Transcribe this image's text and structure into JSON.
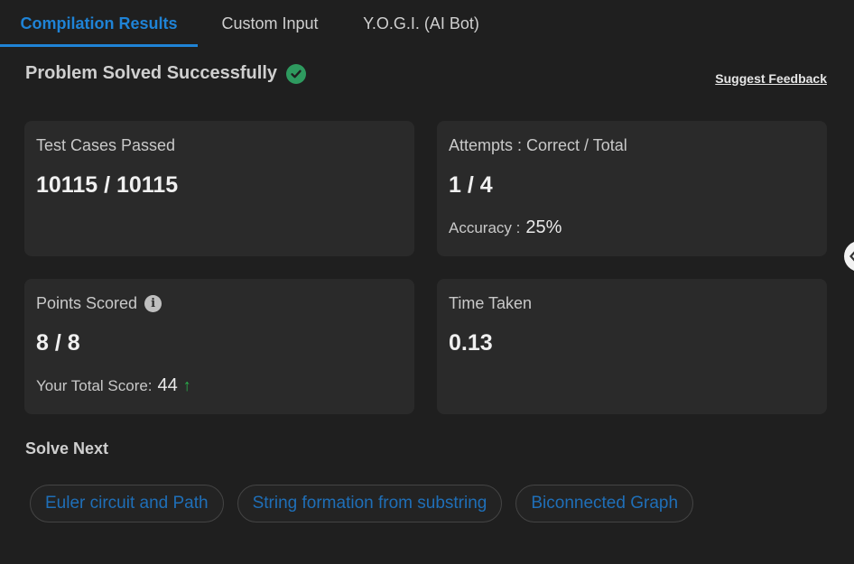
{
  "tabs": [
    {
      "label": "Compilation Results",
      "active": true
    },
    {
      "label": "Custom Input",
      "active": false
    },
    {
      "label": "Y.O.G.I. (AI Bot)",
      "active": false
    }
  ],
  "status": {
    "message": "Problem Solved Successfully",
    "icon": "check-circle-icon"
  },
  "feedback_link": "Suggest Feedback",
  "cards": {
    "test_cases": {
      "label": "Test Cases Passed",
      "value": "10115 / 10115"
    },
    "attempts": {
      "label": "Attempts : Correct / Total",
      "value": "1 / 4",
      "accuracy_label": "Accuracy :",
      "accuracy_value": "25%"
    },
    "points": {
      "label": "Points Scored",
      "value": "8 / 8",
      "total_label": "Your Total Score:",
      "total_value": "44"
    },
    "time": {
      "label": "Time Taken",
      "value": "0.13"
    }
  },
  "solve_next": {
    "title": "Solve Next",
    "items": [
      "Euler circuit and Path",
      "String formation from substring",
      "Biconnected Graph"
    ]
  },
  "colors": {
    "accent": "#1f83d6",
    "success": "#2e9a5f",
    "arrow_up": "#29b24c",
    "background": "#1f1f1f",
    "card": "#2a2a2a"
  }
}
